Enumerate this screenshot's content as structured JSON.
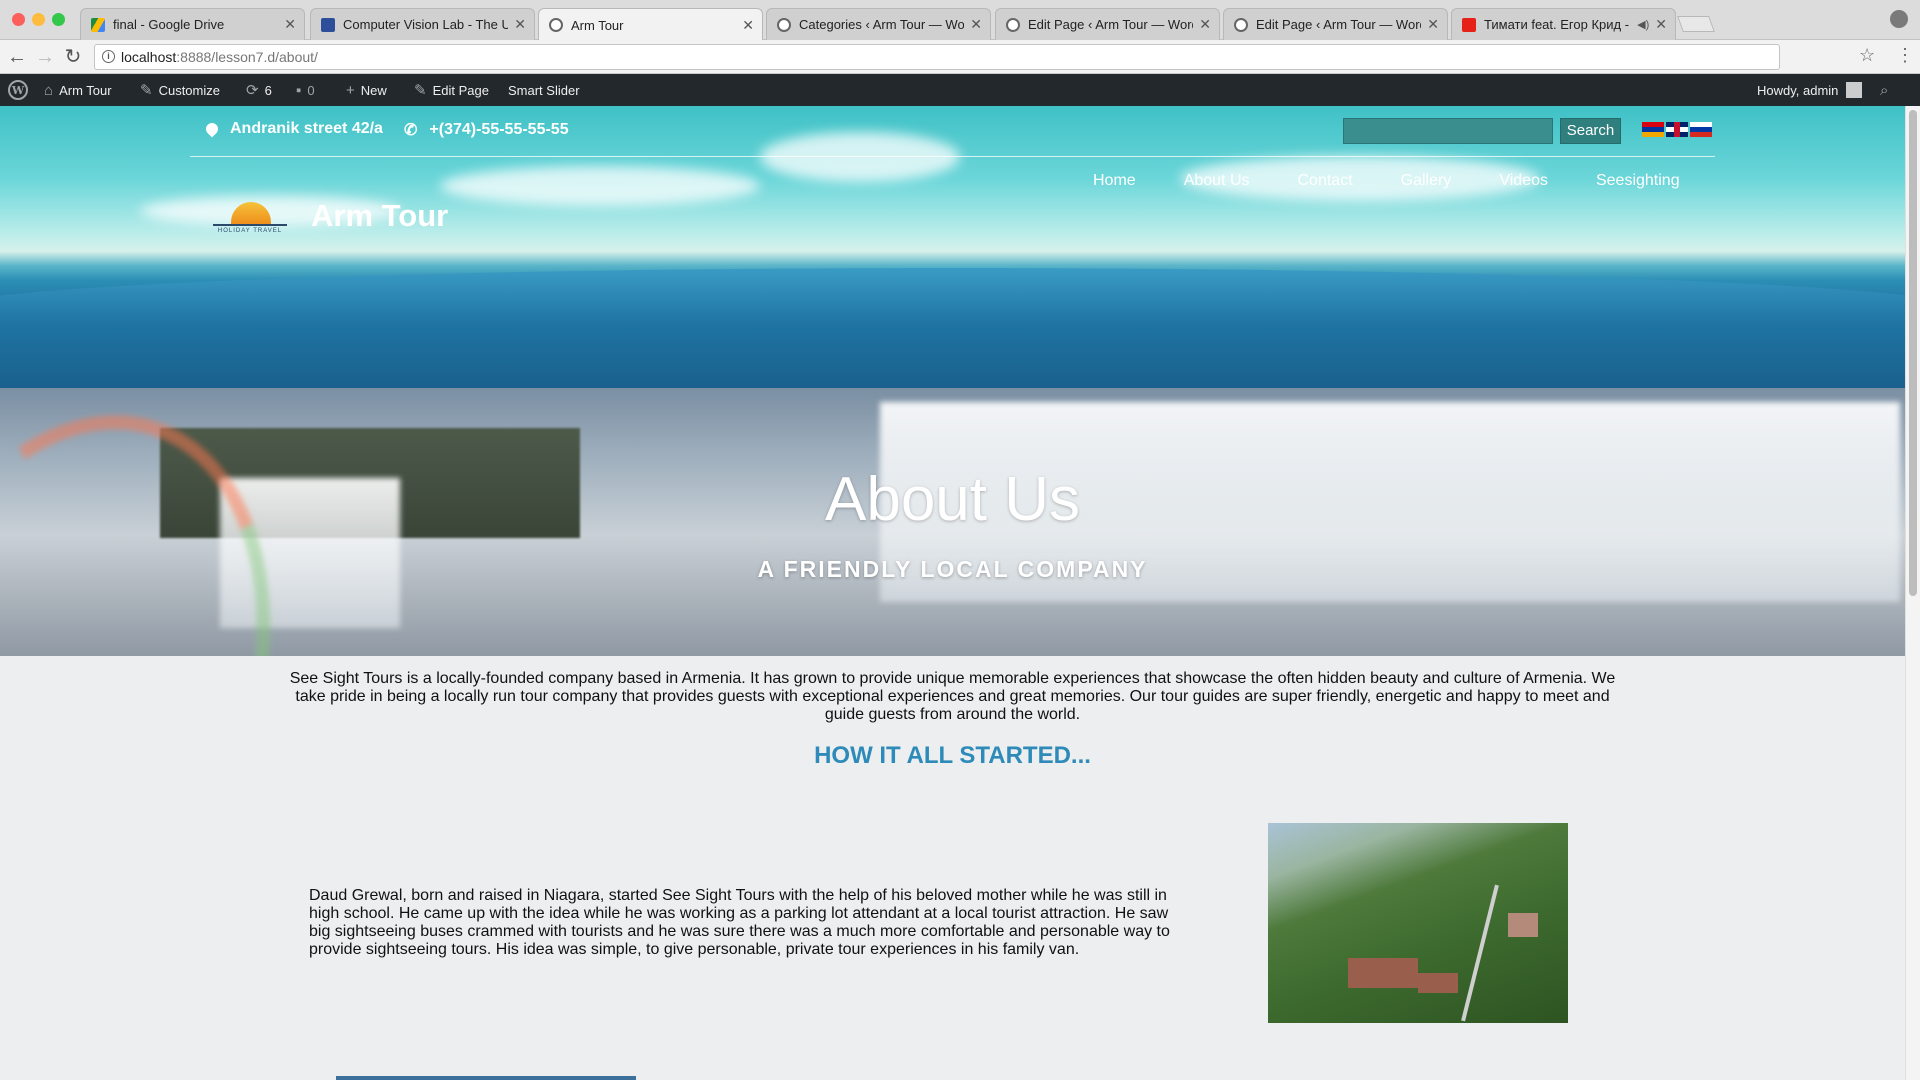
{
  "browser": {
    "tabs": [
      {
        "title": "final - Google Drive",
        "favicon": "google-drive-icon",
        "active": false
      },
      {
        "title": "Computer Vision Lab - The Un",
        "favicon": "facebook-icon",
        "active": false
      },
      {
        "title": "Arm Tour",
        "favicon": "wordpress-icon",
        "active": true
      },
      {
        "title": "Categories ‹ Arm Tour — Word",
        "favicon": "wordpress-icon",
        "active": false
      },
      {
        "title": "Edit Page ‹ Arm Tour — WordP",
        "favicon": "wordpress-icon",
        "active": false
      },
      {
        "title": "Edit Page ‹ Arm Tour — WordP",
        "favicon": "wordpress-icon",
        "active": false
      },
      {
        "title": "Тимати feat. Егор Крид - Г",
        "favicon": "youtube-icon",
        "active": false
      }
    ],
    "url_host": "localhost",
    "url_path": ":8888/lesson7.d/about/"
  },
  "adminbar": {
    "site_name": "Arm Tour",
    "customize": "Customize",
    "updates_count": "6",
    "comments_count": "0",
    "new_label": "New",
    "edit_page": "Edit Page",
    "smart_slider": "Smart Slider",
    "howdy": "Howdy, admin"
  },
  "header": {
    "address": "Andranik street 42/a",
    "phone": "+(374)-55-55-55-55",
    "search_placeholder": "",
    "search_button": "Search",
    "site_title": "Arm Tour",
    "logo_text": "HOLIDAY TRAVEL",
    "nav": [
      "Home",
      "About Us",
      "Contact",
      "Gallery",
      "Videos",
      "Seesighting"
    ],
    "languages": [
      "Armenian",
      "English",
      "Russian"
    ]
  },
  "about": {
    "title": "About Us",
    "subtitle": "A FRIENDLY LOCAL COMPANY",
    "intro": "See Sight Tours is a locally-founded company based in Armenia. It has grown to provide unique memorable experiences that showcase the often hidden beauty and culture of Armenia. We take pride in being a locally run tour company that provides guests with exceptional experiences and great memories. Our tour guides are super friendly, energetic and happy to meet and guide guests from around the world.",
    "section_heading": "HOW IT ALL STARTED...",
    "story": "Daud Grewal, born and raised in Niagara, started See Sight Tours with the help of his beloved mother while he was still in high school. He came up with the idea while he was working as a parking lot attendant at a local tourist attraction. He saw big sightseeing buses crammed with tourists and he was sure there was a much more comfortable and personable way to provide sightseeing tours. His idea was simple, to give personable, private tour experiences in his family van."
  },
  "colors": {
    "admin_bar": "#23282d",
    "heading_blue": "#2e8ab8",
    "search_button": "#2f7f7f"
  }
}
